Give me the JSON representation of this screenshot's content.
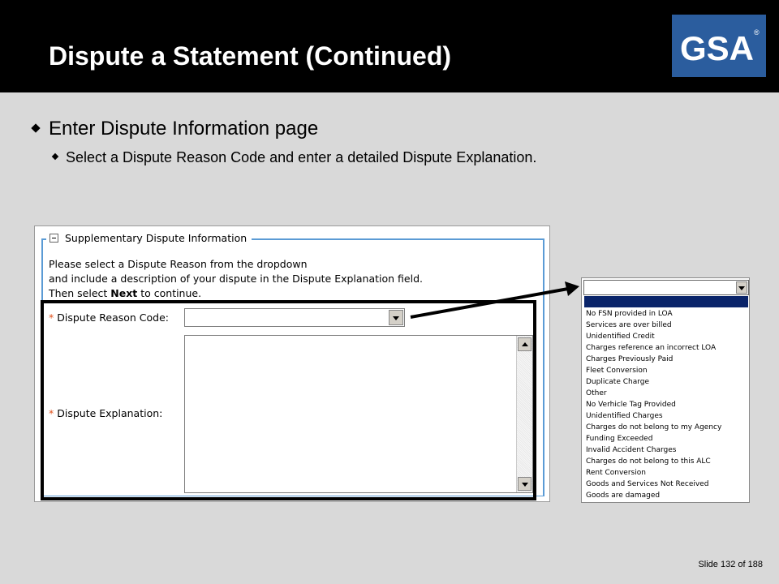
{
  "slide": {
    "title": "Dispute a Statement (Continued)",
    "logo_text": "GSA",
    "logo_mark": "®"
  },
  "bullets": {
    "level1": "Enter Dispute Information page",
    "level2": "Select a Dispute Reason Code and enter a detailed Dispute Explanation."
  },
  "form": {
    "section_legend": "Supplementary Dispute Information",
    "instructions": {
      "line1": "Please select a Dispute Reason from the dropdown",
      "line2": "and include a description of your dispute in the Dispute Explanation field.",
      "line3_prefix": "Then select ",
      "line3_bold": "Next",
      "line3_suffix": " to continue."
    },
    "required_marker": "*",
    "reason_label": "Dispute Reason Code:",
    "reason_value": "",
    "explanation_label": "Dispute Explanation:",
    "explanation_value": ""
  },
  "dropdown": {
    "selected": "",
    "options": [
      "No FSN provided in LOA",
      "Services are over billed",
      "Unidentified Credit",
      "Charges reference an incorrect LOA",
      "Charges Previously Paid",
      "Fleet Conversion",
      "Duplicate Charge",
      "Other",
      "No Verhicle Tag Provided",
      "Unidentified Charges",
      "Charges do not belong to my Agency",
      "Funding Exceeded",
      "Invalid Accident Charges",
      "Charges do not belong to this ALC",
      "Rent Conversion",
      "Goods and Services Not Received",
      "Goods are damaged"
    ]
  },
  "footer": {
    "slide_label": "Slide",
    "slide_number": "132",
    "of_label": "of",
    "total": "188"
  },
  "colors": {
    "title_bar": "#000000",
    "logo_bg": "#2b5d9e",
    "fieldset_border": "#5b9bd5",
    "required": "#e0501b",
    "dropdown_highlight": "#0a246a",
    "background": "#d9d9d9"
  }
}
